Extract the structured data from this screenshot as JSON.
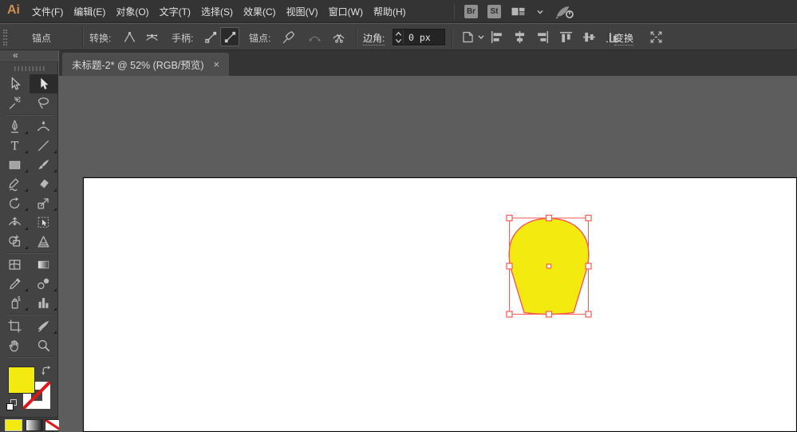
{
  "menu_bar": {
    "logo_text": "Ai",
    "items": [
      "文件(F)",
      "编辑(E)",
      "对象(O)",
      "文字(T)",
      "选择(S)",
      "效果(C)",
      "视图(V)",
      "窗口(W)",
      "帮助(H)"
    ],
    "badges": [
      "Br",
      "St"
    ],
    "right_icons": [
      "workspace-switcher",
      "chevron-down",
      "gpu-performance"
    ]
  },
  "control_bar": {
    "context_label": "锚点",
    "convert_label": "转换:",
    "convert_icons": [
      "convert-anchor-to-corner",
      "convert-anchor-to-smooth"
    ],
    "handles_label": "手柄:",
    "handle_icons": [
      "show-handles-multiple-anchors",
      "hide-handles-multiple-anchors"
    ],
    "handles_active": "hide-handles-multiple-anchors",
    "anchors_label": "锚点:",
    "anchor_icons": [
      "remove-selected-anchor",
      "connect-selected-endpoints",
      "cut-path-at-anchor"
    ],
    "anchors_disabled": "connect-selected-endpoints",
    "corner_label": "边角:",
    "corner_value": "0 px",
    "artboard_menu_icon": "align-to-artboard",
    "align_icons": [
      "align-left",
      "align-center-horizontal",
      "align-right",
      "align-top",
      "align-middle-vertical",
      "align-bottom"
    ],
    "transform_label": "变换",
    "isolate_icon": "isolate-selected-object"
  },
  "document_tab": {
    "title": "未标题-2* @ 52% (RGB/预览)",
    "close_glyph": "×"
  },
  "tools_panel": {
    "collapse_glyph": "«",
    "tools": [
      {
        "icon": "selection"
      },
      {
        "icon": "direct-selection",
        "selected": true
      },
      {
        "icon": "magic-wand"
      },
      {
        "icon": "lasso"
      },
      {
        "icon": "pen"
      },
      {
        "icon": "curvature"
      },
      {
        "icon": "type"
      },
      {
        "icon": "line-segment"
      },
      {
        "icon": "rectangle"
      },
      {
        "icon": "paintbrush"
      },
      {
        "icon": "shaper"
      },
      {
        "icon": "eraser"
      },
      {
        "icon": "rotate"
      },
      {
        "icon": "scale"
      },
      {
        "icon": "width"
      },
      {
        "icon": "free-transform"
      },
      {
        "icon": "shape-builder"
      },
      {
        "icon": "perspective-grid"
      },
      {
        "icon": "mesh"
      },
      {
        "icon": "gradient"
      },
      {
        "icon": "eyedropper"
      },
      {
        "icon": "blend"
      },
      {
        "icon": "symbol-sprayer"
      },
      {
        "icon": "column-graph"
      },
      {
        "icon": "artboard"
      },
      {
        "icon": "slice"
      },
      {
        "icon": "hand"
      },
      {
        "icon": "zoom"
      }
    ],
    "fill_swatch": "#f3ea0f",
    "stroke_swatch": "none",
    "mode_swatches": [
      "color",
      "gradient",
      "none"
    ],
    "active_mode": "color"
  },
  "canvas": {
    "artboard_color": "#ffffff",
    "shape": {
      "kind": "rounded-blob",
      "fill": "#f3ea0f"
    },
    "selection": {
      "handle_count": 8
    }
  },
  "colors": {
    "accent_fill": "#f3ea0f",
    "selection": "#f95b55",
    "logo": "#d08c50",
    "none_red": "#e21616"
  }
}
